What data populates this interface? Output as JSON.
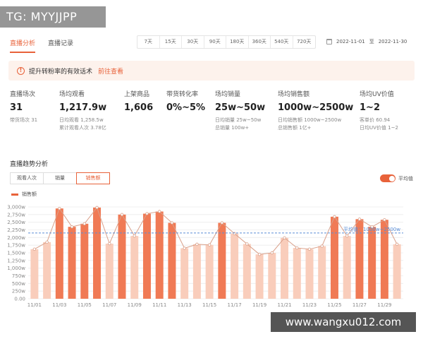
{
  "watermark": "TG: MYYJJPP",
  "url_watermark": "www.wangxu012.com",
  "tabs": [
    "直播分析",
    "直播记录"
  ],
  "date_ranges": [
    "7天",
    "15天",
    "30天",
    "90天",
    "180天",
    "360天",
    "540天",
    "720天"
  ],
  "date_picker": {
    "start": "2022-11-01",
    "separator": "至",
    "end": "2022-11-30"
  },
  "tip": {
    "text": "提升转粉率的有效话术",
    "link": "前往查看"
  },
  "stats": {
    "sessions": {
      "label": "直播场次",
      "value": "31",
      "sub1": "带货场次 31"
    },
    "views": {
      "label": "场均观看",
      "value": "1,217.9w",
      "sub1": "日均观看 1,258.5w",
      "sub2": "累计观看人次 3.78亿"
    },
    "products": {
      "label": "上架商品",
      "value": "1,606"
    },
    "conversion": {
      "label": "带货转化率",
      "value": "0%~5%"
    },
    "sales": {
      "label": "场均销量",
      "value": "25w~50w",
      "sub1": "日均销量 25w~50w",
      "sub2": "总销量 100w+"
    },
    "gmv": {
      "label": "场均销售额",
      "value": "1000w~2500w",
      "sub1": "日均销售额 1000w~2500w",
      "sub2": "总销售额 1亿+"
    },
    "uv": {
      "label": "场均UV价值",
      "value": "1~2",
      "sub1": "客单价 60.94",
      "sub2": "日均UV价值 1~2"
    }
  },
  "section_title": "直播趋势分析",
  "metric_tabs": [
    "观看人次",
    "销量",
    "销售额"
  ],
  "active_metric": 2,
  "toggle_label": "平均值",
  "colors": {
    "accent": "#e8623a",
    "bar_dark": "#f07a55",
    "bar_light": "#f9cdbb",
    "line": "#d9a08a",
    "avg": "#5b8ed6"
  },
  "chart_data": {
    "type": "bar",
    "legend": "销售额",
    "categories": [
      "11/01",
      "11/02",
      "11/03",
      "11/04",
      "11/05",
      "11/06",
      "11/07",
      "11/08",
      "11/09",
      "11/10",
      "11/11",
      "11/12",
      "11/13",
      "11/14",
      "11/15",
      "11/16",
      "11/17",
      "11/18",
      "11/19",
      "11/20",
      "11/21",
      "11/22",
      "11/23",
      "11/24",
      "11/25",
      "11/26",
      "11/27",
      "11/28",
      "11/29",
      "11/30"
    ],
    "xtick_labels": [
      "11/01",
      "11/03",
      "11/05",
      "11/07",
      "11/09",
      "11/11",
      "11/13",
      "11/15",
      "11/17",
      "11/19",
      "11/21",
      "11/23",
      "11/25",
      "11/27",
      "11/29"
    ],
    "values": [
      1620,
      1850,
      2950,
      2350,
      2450,
      2980,
      1800,
      2750,
      2050,
      2780,
      2850,
      2480,
      1650,
      1780,
      1760,
      2480,
      2130,
      1790,
      1450,
      1500,
      1990,
      1660,
      1620,
      1720,
      2680,
      2050,
      2600,
      2350,
      2580,
      1780
    ],
    "highlighted": [
      2,
      3,
      4,
      5,
      7,
      9,
      10,
      11,
      15,
      24,
      26,
      27,
      28
    ],
    "average_line": 2150,
    "average_label": "平均值：1000w~2500w",
    "yticks": [
      "0.00",
      "250w",
      "500w",
      "750w",
      "1,000w",
      "1,250w",
      "1,500w",
      "1,750w",
      "2,000w",
      "2,250w",
      "2,500w",
      "2,750w",
      "3,000w"
    ],
    "ylim": [
      0,
      3000
    ]
  }
}
